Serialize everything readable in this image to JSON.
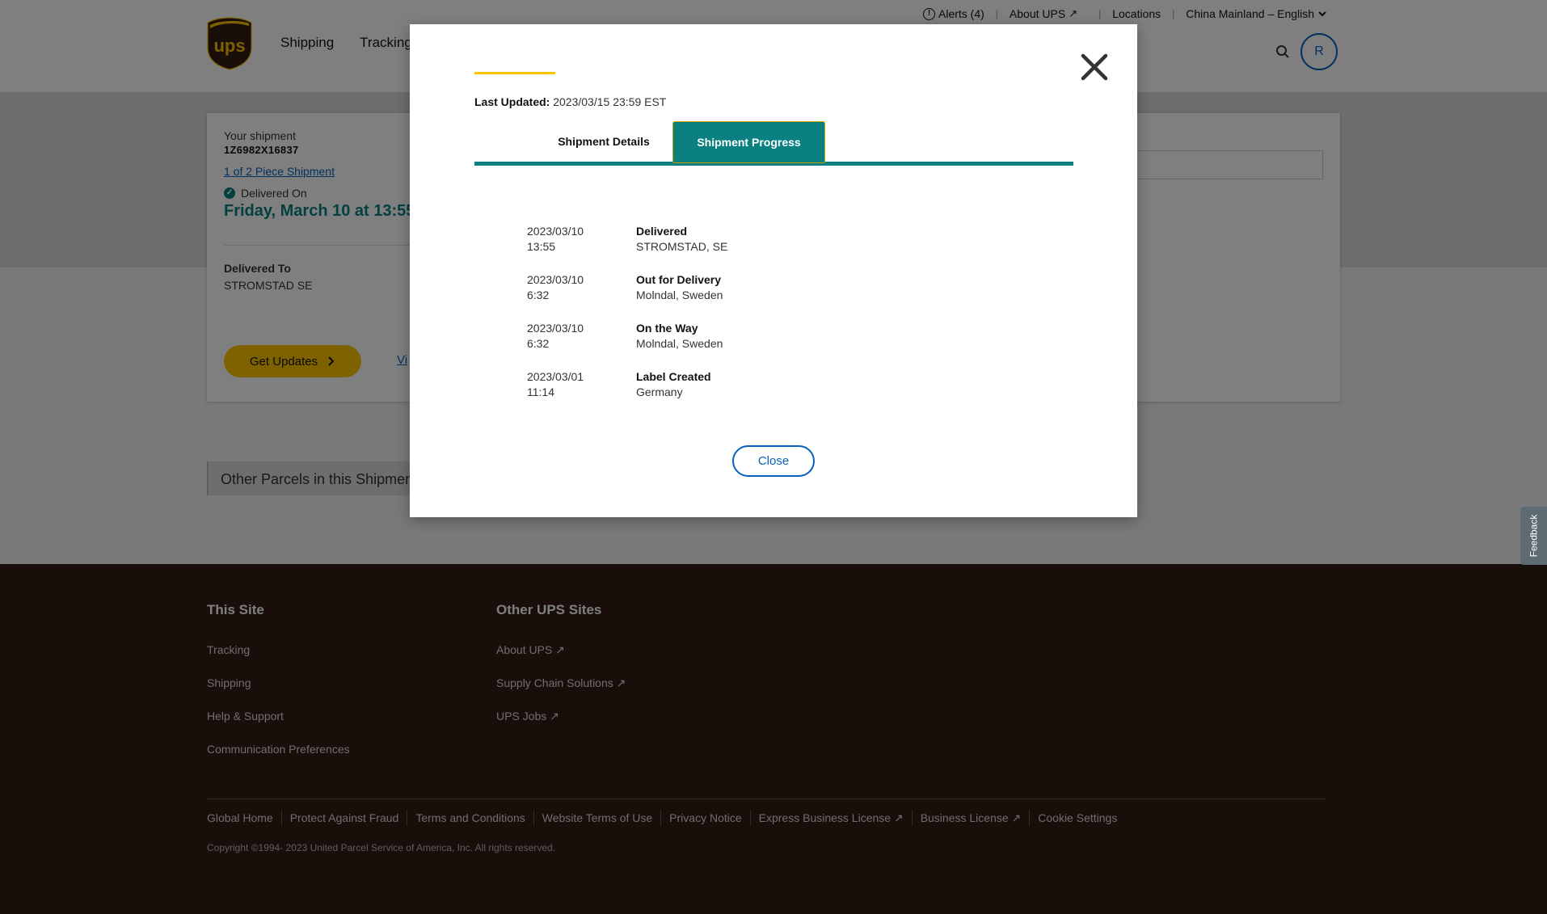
{
  "header": {
    "nav": [
      "Shipping",
      "Tracking"
    ],
    "utility": {
      "alerts": "Alerts (4)",
      "about": "About UPS",
      "locations": "Locations",
      "locale": "China Mainland – English"
    },
    "avatar_initial": "R",
    "logo_text": "ups"
  },
  "shipment": {
    "your_shipment_label": "Your shipment",
    "tracking_number": "1Z6982X16837",
    "piece_link": "1 of 2 Piece Shipment",
    "delivered_on_label": "Delivered On",
    "delivery_date": "Friday, March 10 at 13:55",
    "delivered_to_label": "Delivered To",
    "delivered_to_value": "STROMSTAD SE",
    "get_updates_label": "Get Updates",
    "view_link": "Vi",
    "other_parcels": "Other Parcels in this Shipmen"
  },
  "modal": {
    "last_updated_label": "Last Updated:",
    "last_updated_value": "2023/03/15 23:59 EST",
    "tabs": [
      "Shipment Details",
      "Shipment Progress"
    ],
    "active_tab": "Shipment Progress",
    "events": [
      {
        "date": "2023/03/10",
        "time": "13:55",
        "status": "Delivered",
        "location": "STROMSTAD, SE"
      },
      {
        "date": "2023/03/10",
        "time": "6:32",
        "status": "Out for Delivery",
        "location": "Molndal, Sweden"
      },
      {
        "date": "2023/03/10",
        "time": "6:32",
        "status": "On the Way",
        "location": "Molndal, Sweden"
      },
      {
        "date": "2023/03/01",
        "time": "11:14",
        "status": "Label Created",
        "location": "Germany"
      }
    ],
    "close_label": "Close"
  },
  "footer": {
    "this_site": {
      "title": "This Site",
      "links": [
        "Tracking",
        "Shipping",
        "Help & Support",
        "Communication Preferences"
      ]
    },
    "other_sites": {
      "title": "Other UPS Sites",
      "links": [
        "About UPS",
        "Supply Chain Solutions",
        "UPS Jobs"
      ]
    },
    "legal": [
      "Global Home",
      "Protect Against Fraud",
      "Terms and Conditions",
      "Website Terms of Use",
      "Privacy Notice",
      "Express Business License",
      "Business License",
      "Cookie Settings"
    ],
    "copyright": "Copyright ©1994- 2023 United Parcel Service of America, Inc. All rights reserved."
  },
  "feedback_label": "Feedback",
  "colors": {
    "ups_brown": "#351c15",
    "ups_gold": "#ffc400",
    "teal": "#0a8080",
    "link_blue": "#0662bb"
  }
}
